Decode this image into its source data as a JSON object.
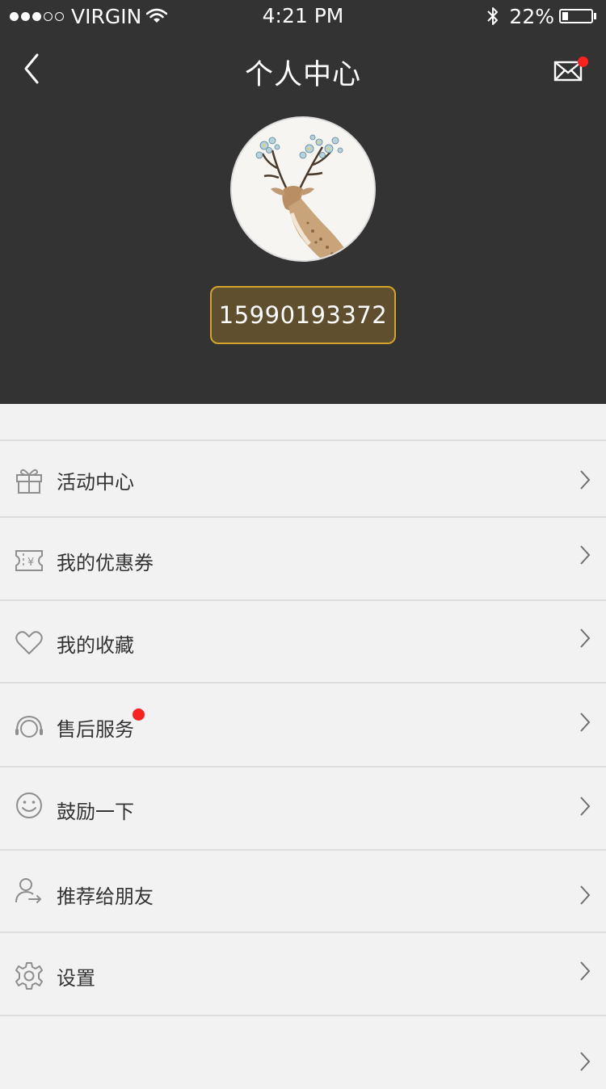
{
  "status_bar": {
    "carrier": "VIRGIN",
    "time": "4:21 PM",
    "battery_percent": "22%",
    "battery_level": 0.22,
    "signal_bars_filled": 3,
    "signal_bars_total": 5
  },
  "nav": {
    "title": "个人中心",
    "back_icon": "chevron-left-icon",
    "mail_icon": "mail-icon",
    "mail_has_notification": true
  },
  "profile": {
    "avatar_desc": "avatar",
    "phone": "15990193372"
  },
  "colors": {
    "header_bg": "#333333",
    "badge_bg": "#5f4f2e",
    "badge_border": "#d4a32c",
    "notification_red": "#ff2020",
    "page_bg": "#f2f2f2"
  },
  "menu": {
    "items": [
      {
        "label": "活动中心",
        "icon": "gift-icon"
      },
      {
        "label": "我的优惠券",
        "icon": "coupon-icon"
      },
      {
        "label": "我的收藏",
        "icon": "heart-icon"
      },
      {
        "label": "售后服务",
        "icon": "headset-icon",
        "has_badge": true
      },
      {
        "label": "鼓励一下",
        "icon": "smile-icon"
      },
      {
        "label": "推荐给朋友",
        "icon": "user-share-icon"
      },
      {
        "label": "设置",
        "icon": "gear-icon"
      },
      {
        "label": "",
        "icon": ""
      }
    ]
  }
}
